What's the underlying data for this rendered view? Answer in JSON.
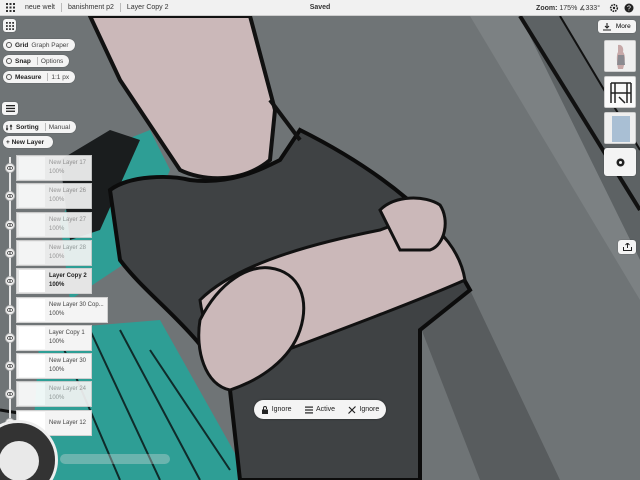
{
  "topbar": {
    "crumbs": [
      "neue welt",
      "banishment p2",
      "Layer Copy 2"
    ],
    "status": "Saved",
    "zoom_label": "Zoom:",
    "zoom_value": "175% ∡333°"
  },
  "tools": {
    "grid": {
      "label": "Grid",
      "option": "Graph Paper"
    },
    "snap": {
      "label": "Snap",
      "option": "Options"
    },
    "measure": {
      "label": "Measure",
      "option": "1:1 px"
    }
  },
  "layers_panel": {
    "sorting_label": "Sorting",
    "sorting_value": "Manual",
    "new_layer_button": "+ New Layer",
    "layers": [
      {
        "name": "New Layer 17",
        "opacity": "100%",
        "state": "dim"
      },
      {
        "name": "New Layer 26",
        "opacity": "100%",
        "state": "dim"
      },
      {
        "name": "New Layer 27",
        "opacity": "100%",
        "state": "dim"
      },
      {
        "name": "New Layer 28",
        "opacity": "100%",
        "state": "dim"
      },
      {
        "name": "Layer Copy 2",
        "opacity": "100%",
        "state": "active"
      },
      {
        "name": "New Layer 30 Cop...",
        "opacity": "100%",
        "state": "visible"
      },
      {
        "name": "Layer Copy 1",
        "opacity": "100%",
        "state": "visible"
      },
      {
        "name": "New Layer 30",
        "opacity": "100%",
        "state": "visible"
      },
      {
        "name": "New Layer 24",
        "opacity": "100%",
        "state": "dim"
      },
      {
        "name": "New Layer 12",
        "opacity": "",
        "state": "visible"
      }
    ]
  },
  "right_panel": {
    "more_label": "More"
  },
  "bottom_toolbar": {
    "lock_label": "Ignore",
    "layers_label": "Active",
    "other_label": "Ignore"
  },
  "colors": {
    "background_gray": "#6f7476",
    "shirt": "#3f4244",
    "skin": "#cbb8b9",
    "teal": "#2e9e95",
    "panel": "#f4f4f4"
  },
  "icons": [
    "grid-icon",
    "download-icon",
    "settings-icon",
    "help-icon",
    "menu-icon",
    "eye-icon",
    "record-icon",
    "share-icon",
    "lock-icon",
    "layers-icon",
    "transform-icon"
  ]
}
